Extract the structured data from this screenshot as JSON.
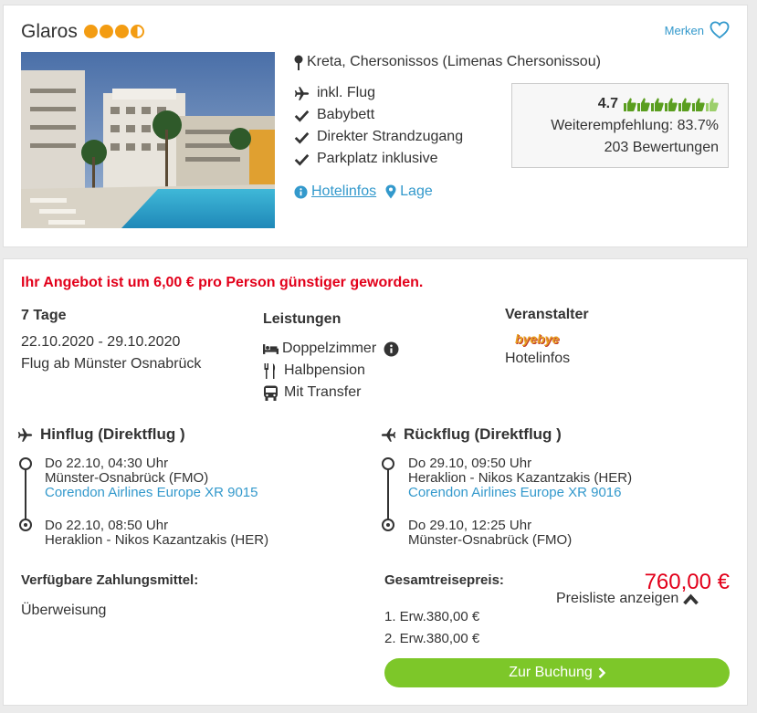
{
  "hotel": {
    "name": "Glaros",
    "star_rating": 3.5,
    "merken_label": "Merken",
    "location": "Kreta, Chersonissos (Limenas Chersonissou)",
    "features": [
      {
        "icon": "plane-icon",
        "label": "inkl. Flug"
      },
      {
        "icon": "check-icon",
        "label": "Babybett"
      },
      {
        "icon": "check-icon",
        "label": "Direkter Strandzugang"
      },
      {
        "icon": "check-icon",
        "label": "Parkplatz inklusive"
      }
    ],
    "links": {
      "hotelinfos": "Hotelinfos",
      "lage": "Lage"
    },
    "rating": {
      "score": "4.7",
      "thumbs_filled": 6,
      "thumbs_total": 7,
      "recommendation": "Weiterempfehlung: 83.7%",
      "reviews": "203 Bewertungen"
    }
  },
  "offer": {
    "price_message": "Ihr Angebot ist um 6,00 € pro Person günstiger geworden.",
    "duration": "7 Tage",
    "dates": "22.10.2020 - 29.10.2020",
    "departure": "Flug ab Münster Osnabrück",
    "services_title": "Leistungen",
    "services": [
      {
        "icon": "bed-icon",
        "label": "Doppelzimmer"
      },
      {
        "icon": "cutlery-icon",
        "label": "Halbpension"
      },
      {
        "icon": "bus-icon",
        "label": "Mit Transfer"
      }
    ],
    "operator_title": "Veranstalter",
    "operator_logo": "byebye",
    "operator_link": "Hotelinfos",
    "outbound": {
      "title": "Hinflug (Direktflug )",
      "dep_time": "Do 22.10, 04:30 Uhr",
      "dep_airport": "Münster-Osnabrück (FMO)",
      "airline": "Corendon Airlines Europe XR 9015",
      "arr_time": "Do 22.10, 08:50 Uhr",
      "arr_airport": "Heraklion - Nikos Kazantzakis (HER)"
    },
    "return": {
      "title": "Rückflug (Direktflug )",
      "dep_time": "Do 29.10, 09:50 Uhr",
      "dep_airport": "Heraklion - Nikos Kazantzakis (HER)",
      "airline": "Corendon Airlines Europe XR 9016",
      "arr_time": "Do 29.10, 12:25 Uhr",
      "arr_airport": "Münster-Osnabrück (FMO)"
    },
    "payment_title": "Verfügbare Zahlungsmittel:",
    "payment_method": "Überweisung",
    "total_title": "Gesamtreisepreis:",
    "total_price": "760,00 €",
    "pricelist_label": "Preisliste anzeigen",
    "price_rows": [
      "1. Erw.380,00 €",
      "2. Erw.380,00 €"
    ],
    "booking_button": "Zur Buchung"
  },
  "colors": {
    "accent_blue": "#3399cc",
    "price_red": "#e2001a",
    "button_green": "#7dc729",
    "star_orange": "#f39c12",
    "thumb_green": "#5a9e1f"
  }
}
